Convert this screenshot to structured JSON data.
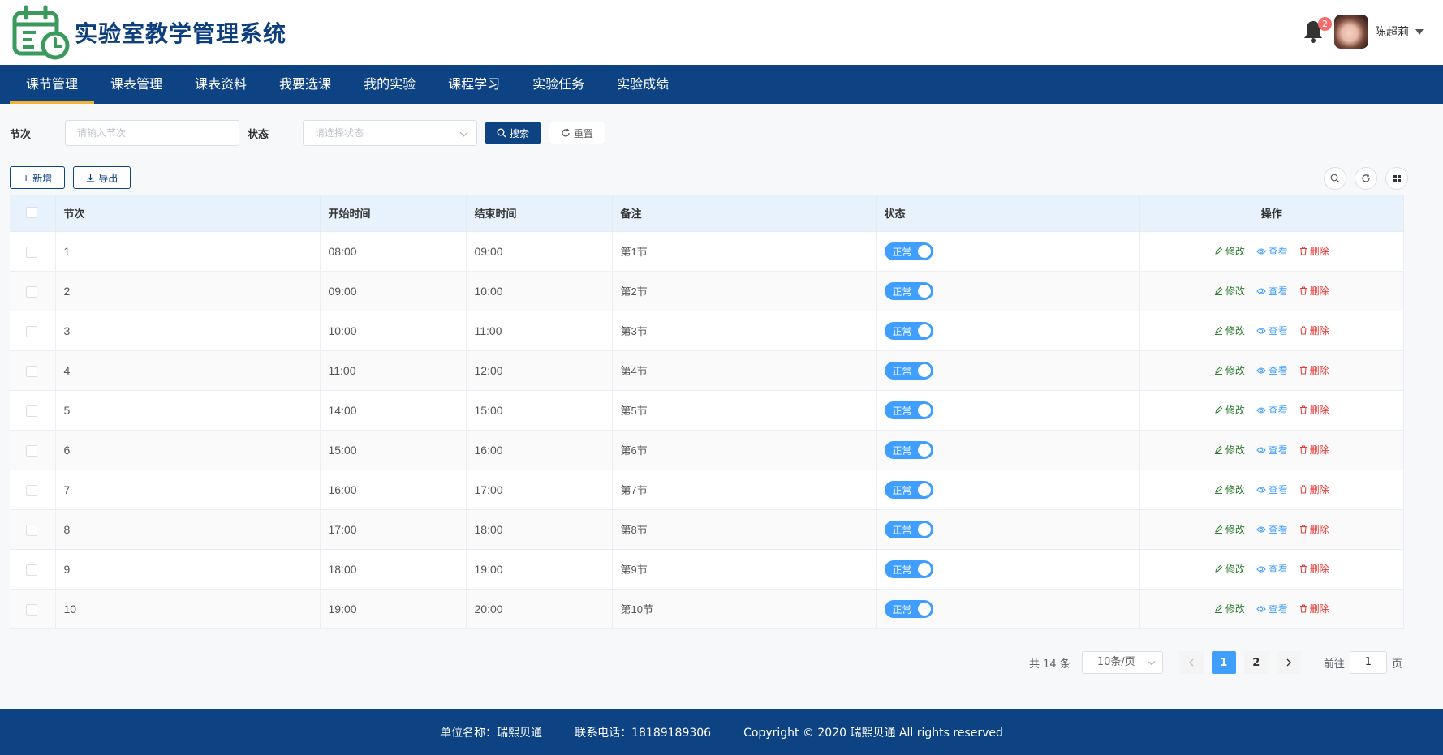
{
  "app": {
    "title": "实验室教学管理系统"
  },
  "header": {
    "notification_count": "2",
    "user_name": "陈超莉"
  },
  "nav": [
    {
      "label": "课节管理",
      "active": true
    },
    {
      "label": "课表管理"
    },
    {
      "label": "课表资料"
    },
    {
      "label": "我要选课"
    },
    {
      "label": "我的实验"
    },
    {
      "label": "课程学习"
    },
    {
      "label": "实验任务"
    },
    {
      "label": "实验成绩"
    }
  ],
  "search": {
    "section_label": "节次",
    "section_placeholder": "请输入节次",
    "status_label": "状态",
    "status_placeholder": "请选择状态",
    "search_button": "搜索",
    "reset_button": "重置"
  },
  "toolbar": {
    "add_button": "新增",
    "export_button": "导出"
  },
  "table": {
    "headers": {
      "section": "节次",
      "start": "开始时间",
      "end": "结束时间",
      "note": "备注",
      "status": "状态",
      "actions": "操作"
    },
    "actions": {
      "edit": "修改",
      "view": "查看",
      "delete": "删除"
    },
    "rows": [
      {
        "section": "1",
        "start": "08:00",
        "end": "09:00",
        "note": "第1节",
        "status": "正常"
      },
      {
        "section": "2",
        "start": "09:00",
        "end": "10:00",
        "note": "第2节",
        "status": "正常"
      },
      {
        "section": "3",
        "start": "10:00",
        "end": "11:00",
        "note": "第3节",
        "status": "正常"
      },
      {
        "section": "4",
        "start": "11:00",
        "end": "12:00",
        "note": "第4节",
        "status": "正常"
      },
      {
        "section": "5",
        "start": "14:00",
        "end": "15:00",
        "note": "第5节",
        "status": "正常"
      },
      {
        "section": "6",
        "start": "15:00",
        "end": "16:00",
        "note": "第6节",
        "status": "正常"
      },
      {
        "section": "7",
        "start": "16:00",
        "end": "17:00",
        "note": "第7节",
        "status": "正常"
      },
      {
        "section": "8",
        "start": "17:00",
        "end": "18:00",
        "note": "第8节",
        "status": "正常"
      },
      {
        "section": "9",
        "start": "18:00",
        "end": "19:00",
        "note": "第9节",
        "status": "正常"
      },
      {
        "section": "10",
        "start": "19:00",
        "end": "20:00",
        "note": "第10节",
        "status": "正常"
      }
    ]
  },
  "pagination": {
    "total_text": "共 14 条",
    "page_size": "10条/页",
    "pages": [
      "1",
      "2"
    ],
    "current_page": "1",
    "goto_prefix": "前往",
    "goto_value": "1",
    "goto_suffix": "页"
  },
  "footer": {
    "unit": "单位名称：瑞熙贝通",
    "phone": "联系电话：18189189306",
    "copyright": "Copyright © 2020 瑞熙贝通 All rights reserved"
  },
  "colors": {
    "brand": "#0d4283",
    "accent": "#f2b233",
    "primary": "#409eff",
    "edit": "#2e7d32",
    "delete": "#e53935"
  }
}
